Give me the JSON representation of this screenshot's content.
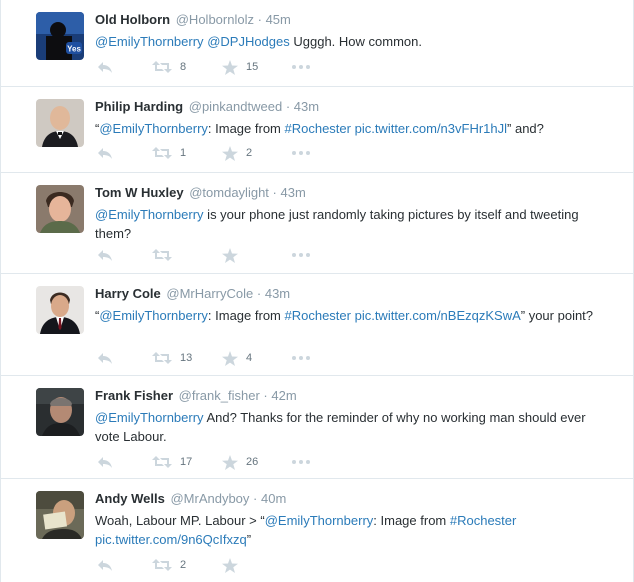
{
  "colors": {
    "link": "#2b7bb9",
    "meta": "#8899a6",
    "text": "#292f33",
    "icon": "#ccd6dd"
  },
  "tweets": [
    {
      "avatar": "yes-campaign-avatar",
      "name": "Old Holborn",
      "handle": "@Holbornlolz",
      "sep": "·",
      "time": "45m",
      "parts": [
        {
          "t": "@EmilyThornberry",
          "link": true
        },
        {
          "t": " ",
          "link": false
        },
        {
          "t": "@DPJHodges",
          "link": true
        },
        {
          "t": " Ugggh. How common.",
          "link": false
        }
      ],
      "retweets": "8",
      "favorites": "15"
    },
    {
      "avatar": "bald-man-avatar",
      "name": "Philip Harding",
      "handle": "@pinkandtweed",
      "sep": "·",
      "time": "43m",
      "parts": [
        {
          "t": "“",
          "link": false
        },
        {
          "t": "@EmilyThornberry",
          "link": true
        },
        {
          "t": ": Image from ",
          "link": false
        },
        {
          "t": "#Rochester",
          "link": true
        },
        {
          "t": " ",
          "link": false
        },
        {
          "t": "pic.twitter.com/n3vFHr1hJl",
          "link": true
        },
        {
          "t": "” and?",
          "link": false
        }
      ],
      "retweets": "1",
      "favorites": "2"
    },
    {
      "avatar": "young-man-avatar",
      "name": "Tom W Huxley",
      "handle": "@tomdaylight",
      "sep": "·",
      "time": "43m",
      "parts": [
        {
          "t": "@EmilyThornberry",
          "link": true
        },
        {
          "t": " is your phone just randomly taking pictures by itself and tweeting them?",
          "link": false
        }
      ],
      "retweets": "",
      "favorites": ""
    },
    {
      "avatar": "suited-man-avatar",
      "name": "Harry Cole",
      "handle": "@MrHarryCole",
      "sep": "·",
      "time": "43m",
      "parts": [
        {
          "t": "“",
          "link": false
        },
        {
          "t": "@EmilyThornberry",
          "link": true
        },
        {
          "t": ": Image from ",
          "link": false
        },
        {
          "t": "#Rochester",
          "link": true
        },
        {
          "t": " ",
          "link": false
        },
        {
          "t": "pic.twitter.com/nBEzqzKSwA",
          "link": true
        },
        {
          "t": "” your point?",
          "link": false
        }
      ],
      "retweets": "13",
      "favorites": "4"
    },
    {
      "avatar": "older-man-avatar",
      "name": "Frank Fisher",
      "handle": "@frank_fisher",
      "sep": "·",
      "time": "42m",
      "parts": [
        {
          "t": "@EmilyThornberry",
          "link": true
        },
        {
          "t": " And? Thanks for the reminder of why no working man should ever vote Labour.",
          "link": false
        }
      ],
      "retweets": "17",
      "favorites": "26"
    },
    {
      "avatar": "man-with-card-avatar",
      "name": "Andy Wells",
      "handle": "@MrAndyboy",
      "sep": "·",
      "time": "40m",
      "parts": [
        {
          "t": "Woah, Labour MP. Labour > “",
          "link": false
        },
        {
          "t": "@EmilyThornberry",
          "link": true
        },
        {
          "t": ": Image from ",
          "link": false
        },
        {
          "t": "#Rochester",
          "link": true
        },
        {
          "t": " ",
          "link": false
        },
        {
          "t": "pic.twitter.com/9n6QcIfxzq",
          "link": true
        },
        {
          "t": "”",
          "link": false
        }
      ],
      "retweets": "2",
      "favorites": ""
    }
  ]
}
